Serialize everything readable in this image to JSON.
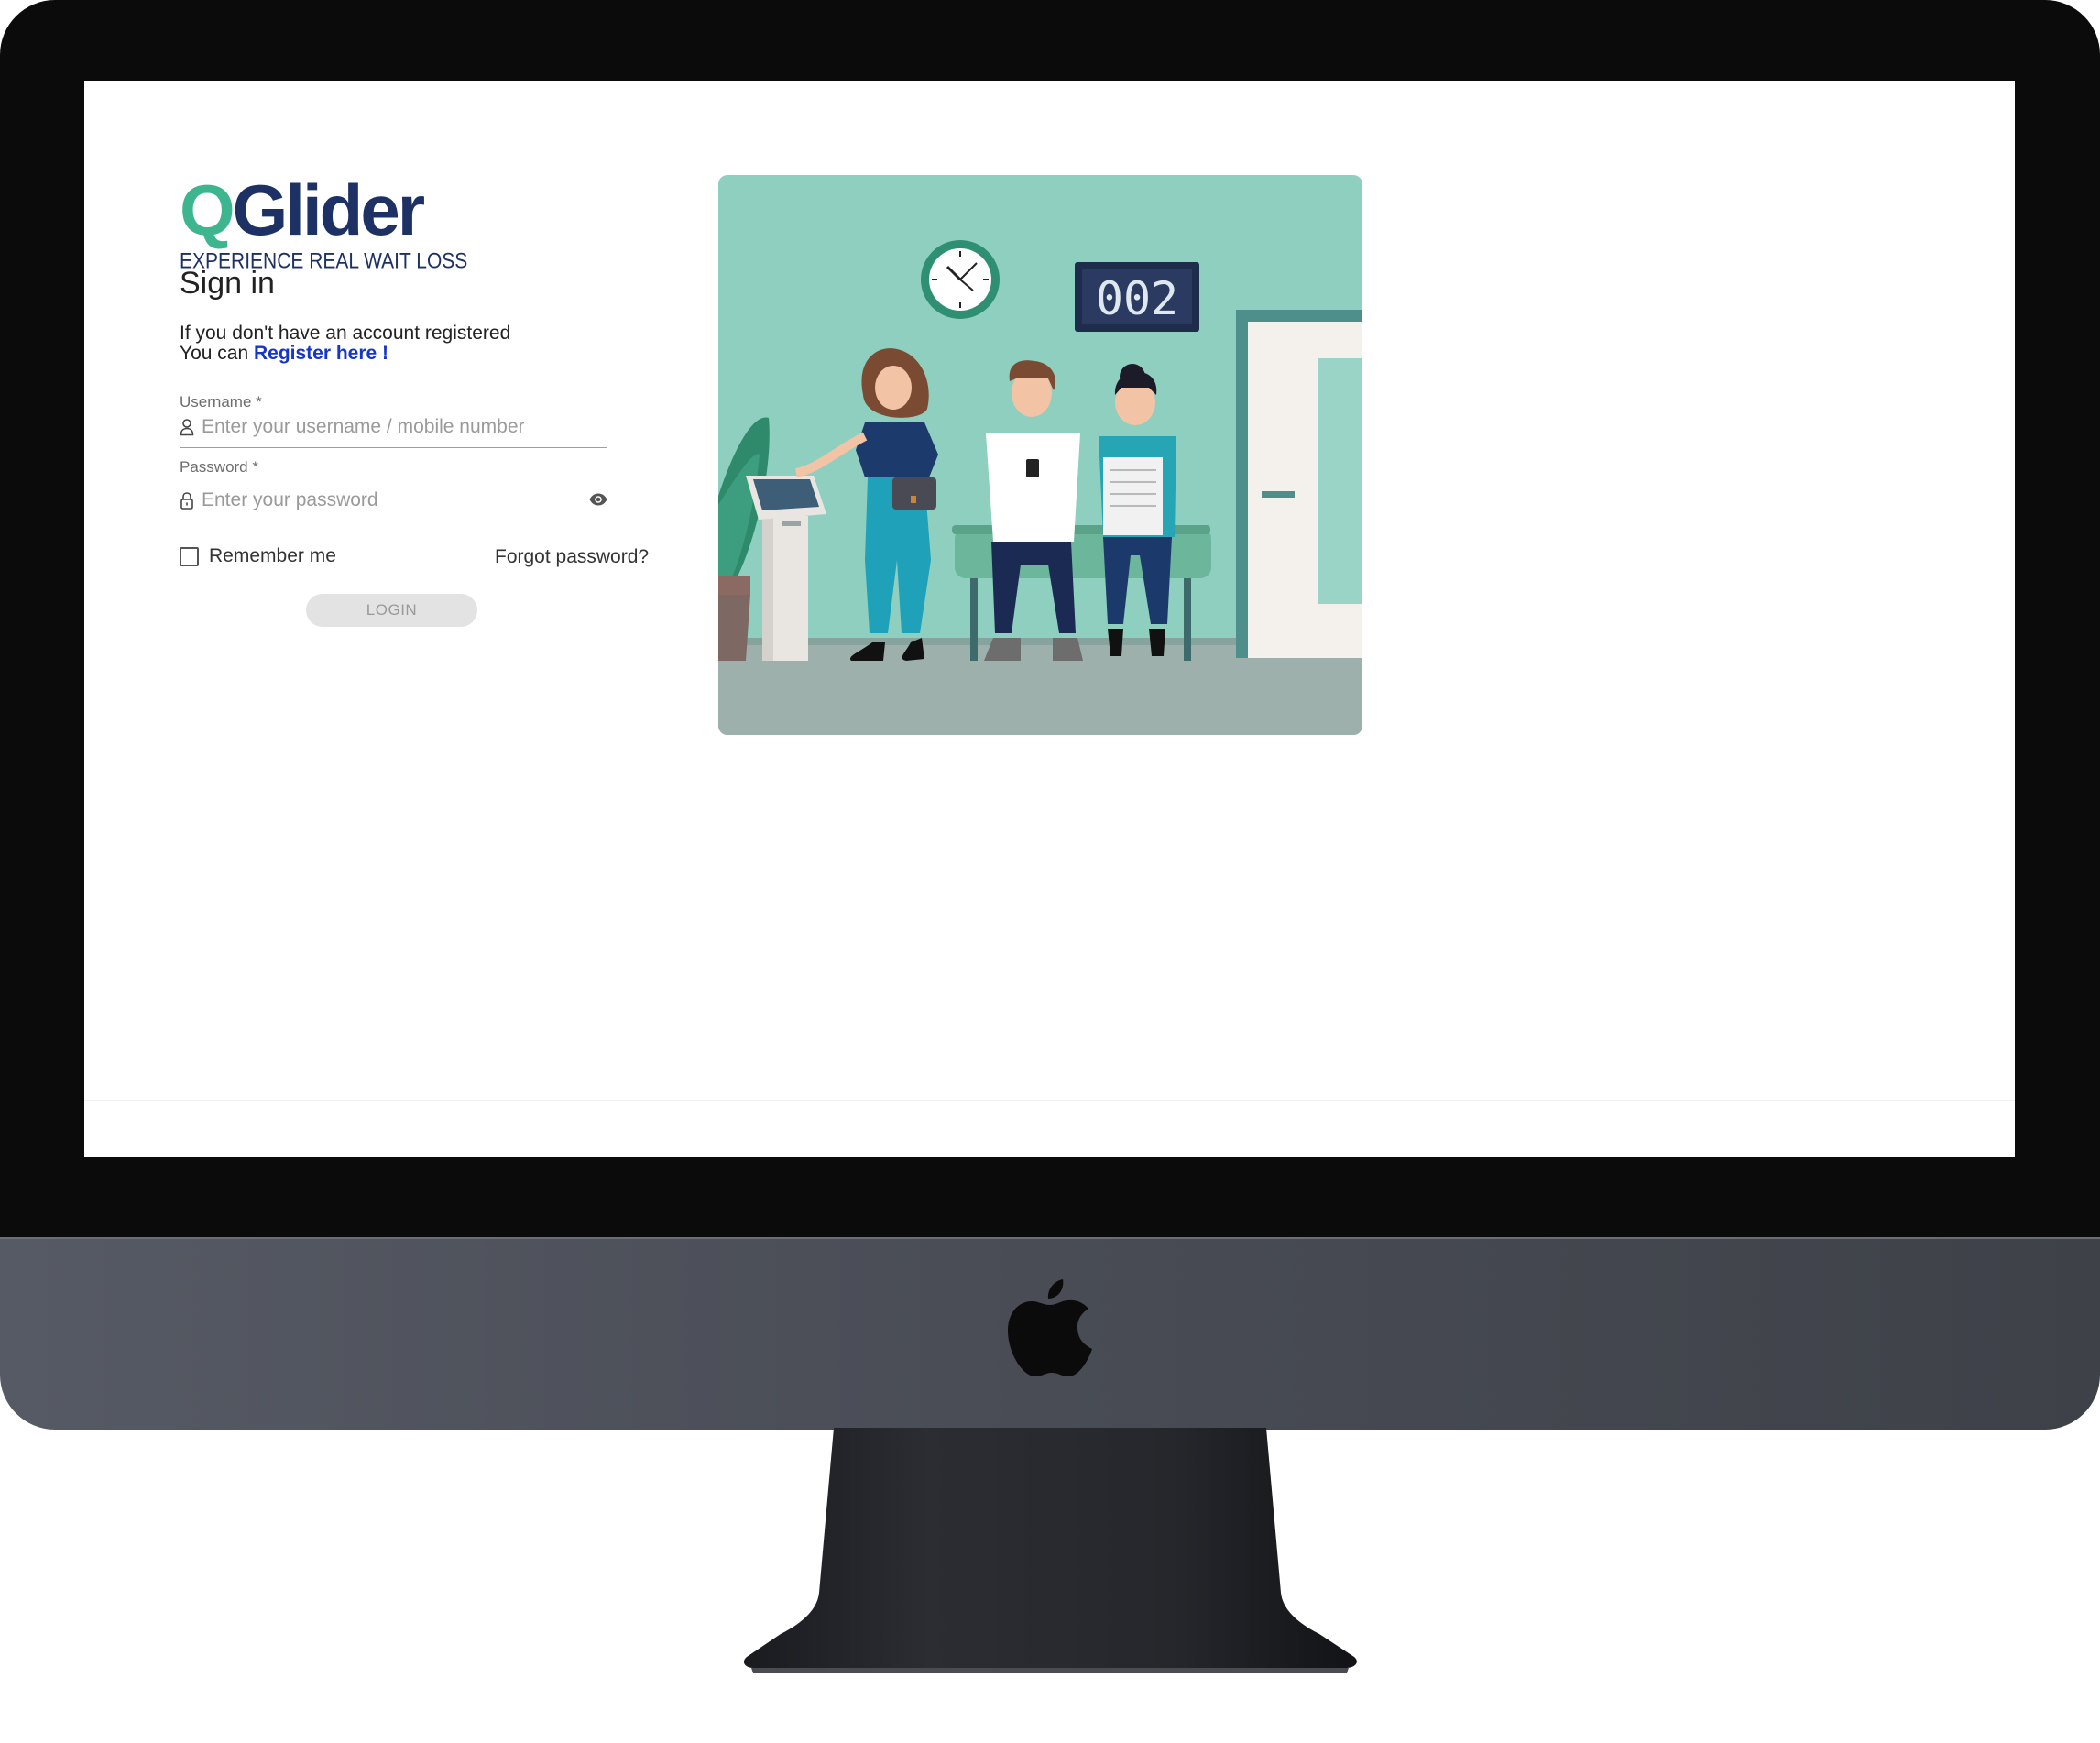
{
  "brand": {
    "name_q": "Q",
    "name_rest": "Glider",
    "tagline": "EXPERIENCE REAL WAIT LOSS",
    "colors": {
      "primary": "#1d3164",
      "accent": "#3db58f"
    }
  },
  "signin": {
    "title": "Sign in",
    "intro_line1": "If you don't have an account registered",
    "intro_line2_prefix": "You can ",
    "register_link": "Register here !",
    "username_label": "Username *",
    "username_placeholder": "Enter your username / mobile number",
    "username_icon": "user-icon",
    "password_label": "Password *",
    "password_placeholder": "Enter your password",
    "password_icon": "lock-icon",
    "toggle_icon": "eye-icon",
    "remember_label": "Remember me",
    "forgot_link": "Forgot password?",
    "login_button": "LOGIN"
  },
  "illustration": {
    "counter_display": "002",
    "background": "#8ecfbf"
  }
}
